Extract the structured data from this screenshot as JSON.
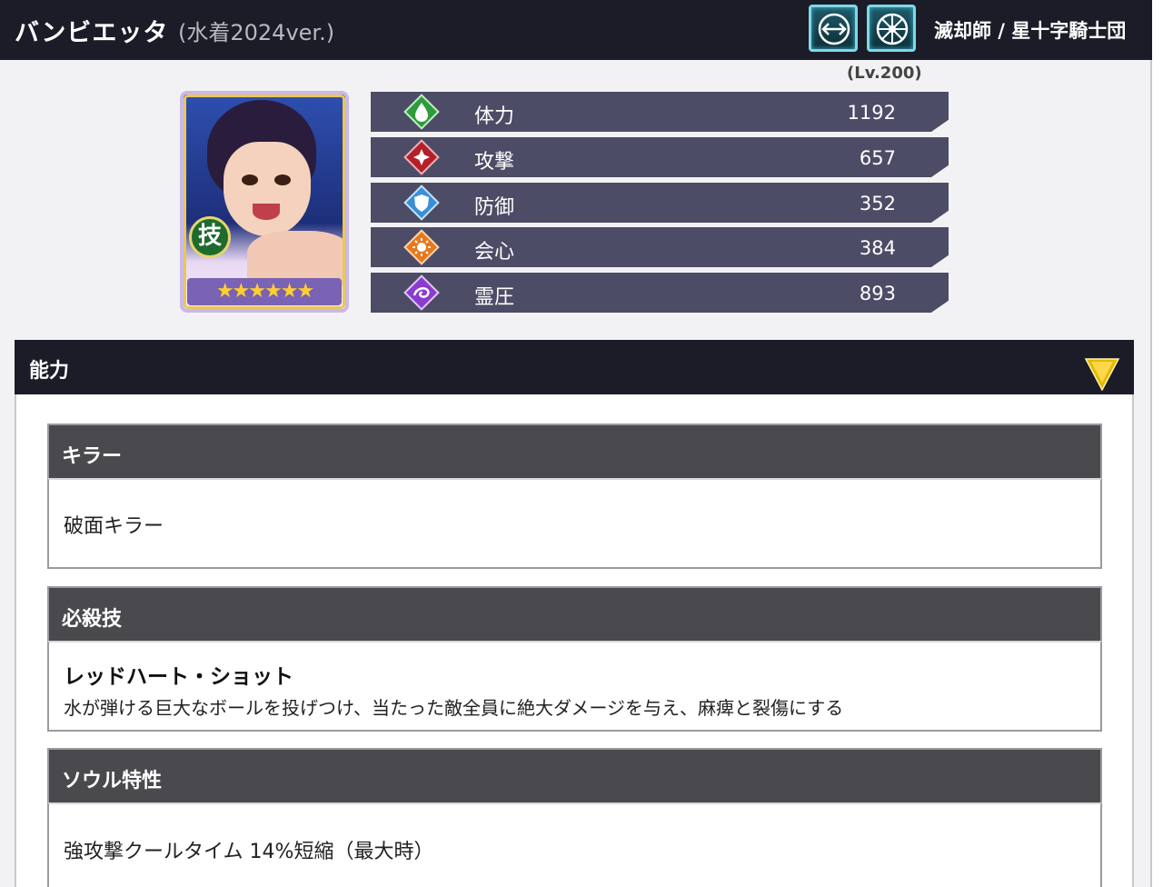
{
  "header": {
    "character_name": "バンビエッタ",
    "variant": "(水着2024ver.)",
    "type_icons": [
      "bow-type-icon",
      "wheel-type-icon"
    ],
    "faction": "滅却師 / 星十字騎士団"
  },
  "level": "(Lv.200)",
  "portrait": {
    "skill_badge": "技",
    "stars": "★★★★★★",
    "rarity_stars": 6
  },
  "stats": [
    {
      "label": "体力",
      "value": "1192",
      "icon": "hp-drop-icon",
      "color": "#2f9b3b"
    },
    {
      "label": "攻撃",
      "value": "657",
      "icon": "attack-icon",
      "color": "#b3202a"
    },
    {
      "label": "防御",
      "value": "352",
      "icon": "defense-shield-icon",
      "color": "#3a8fd6"
    },
    {
      "label": "会心",
      "value": "384",
      "icon": "critical-sun-icon",
      "color": "#e8781c"
    },
    {
      "label": "霊圧",
      "value": "893",
      "icon": "spirit-pressure-icon",
      "color": "#8a3bd0"
    }
  ],
  "ability": {
    "title": "能力",
    "cards": [
      {
        "heading": "キラー",
        "text": "破面キラー"
      },
      {
        "heading": "必殺技",
        "skill_name": "レッドハート・ショット",
        "description": "水が弾ける巨大なボールを投げつけ、当たった敵全員に絶大ダメージを与え、麻痺と裂傷にする"
      },
      {
        "heading": "ソウル特性",
        "text": "強攻撃クールタイム 14%短縮（最大時）"
      }
    ]
  }
}
